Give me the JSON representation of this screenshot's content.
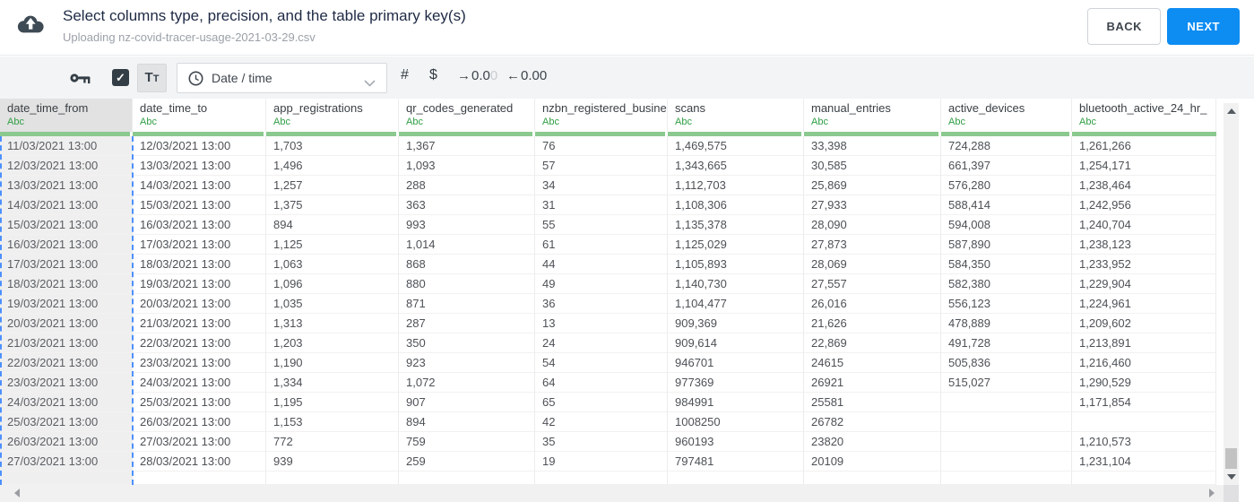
{
  "header": {
    "title": "Select columns type, precision, and the table primary key(s)",
    "subtitle": "Uploading nz-covid-tracer-usage-2021-03-29.csv",
    "back_label": "BACK",
    "next_label": "NEXT"
  },
  "toolbar": {
    "key_icon": "primary-key-icon",
    "checkbox_checked": true,
    "check_glyph": "✓",
    "text_type": {
      "big": "T",
      "small": "T"
    },
    "type_dropdown": {
      "value": "Date / time",
      "icon": "clock-icon"
    },
    "number_symbol": "#",
    "currency_symbol": "$",
    "increase_decimal": {
      "arrow": "→",
      "dark": "0.0",
      "light": "0"
    },
    "decrease_decimal": {
      "arrow": "←",
      "dark": "0.00"
    }
  },
  "table": {
    "columns": [
      {
        "name": "date_time_from",
        "type": "Abc",
        "selected": true
      },
      {
        "name": "date_time_to",
        "type": "Abc",
        "selected": false
      },
      {
        "name": "app_registrations",
        "type": "Abc",
        "selected": false
      },
      {
        "name": "qr_codes_generated",
        "type": "Abc",
        "selected": false
      },
      {
        "name": "nzbn_registered_busine",
        "type": "Abc",
        "selected": false
      },
      {
        "name": "scans",
        "type": "Abc",
        "selected": false
      },
      {
        "name": "manual_entries",
        "type": "Abc",
        "selected": false
      },
      {
        "name": "active_devices",
        "type": "Abc",
        "selected": false
      },
      {
        "name": "bluetooth_active_24_hr_",
        "type": "Abc",
        "selected": false
      }
    ],
    "rows": [
      [
        "11/03/2021 13:00",
        "12/03/2021 13:00",
        "1,703",
        "1,367",
        "76",
        "1,469,575",
        "33,398",
        "724,288",
        "1,261,266"
      ],
      [
        "12/03/2021 13:00",
        "13/03/2021 13:00",
        "1,496",
        "1,093",
        "57",
        "1,343,665",
        "30,585",
        "661,397",
        "1,254,171"
      ],
      [
        "13/03/2021 13:00",
        "14/03/2021 13:00",
        "1,257",
        "288",
        "34",
        "1,112,703",
        "25,869",
        "576,280",
        "1,238,464"
      ],
      [
        "14/03/2021 13:00",
        "15/03/2021 13:00",
        "1,375",
        "363",
        "31",
        "1,108,306",
        "27,933",
        "588,414",
        "1,242,956"
      ],
      [
        "15/03/2021 13:00",
        "16/03/2021 13:00",
        "894",
        "993",
        "55",
        "1,135,378",
        "28,090",
        "594,008",
        "1,240,704"
      ],
      [
        "16/03/2021 13:00",
        "17/03/2021 13:00",
        "1,125",
        "1,014",
        "61",
        "1,125,029",
        "27,873",
        "587,890",
        "1,238,123"
      ],
      [
        "17/03/2021 13:00",
        "18/03/2021 13:00",
        "1,063",
        "868",
        "44",
        "1,105,893",
        "28,069",
        "584,350",
        "1,233,952"
      ],
      [
        "18/03/2021 13:00",
        "19/03/2021 13:00",
        "1,096",
        "880",
        "49",
        "1,140,730",
        "27,557",
        "582,380",
        "1,229,904"
      ],
      [
        "19/03/2021 13:00",
        "20/03/2021 13:00",
        "1,035",
        "871",
        "36",
        "1,104,477",
        "26,016",
        "556,123",
        "1,224,961"
      ],
      [
        "20/03/2021 13:00",
        "21/03/2021 13:00",
        "1,313",
        "287",
        "13",
        "909,369",
        "21,626",
        "478,889",
        "1,209,602"
      ],
      [
        "21/03/2021 13:00",
        "22/03/2021 13:00",
        "1,203",
        "350",
        "24",
        "909,614",
        "22,869",
        "491,728",
        "1,213,891"
      ],
      [
        "22/03/2021 13:00",
        "23/03/2021 13:00",
        "1,190",
        "923",
        "54",
        "946701",
        "24615",
        "505,836",
        "1,216,460"
      ],
      [
        "23/03/2021 13:00",
        "24/03/2021 13:00",
        "1,334",
        "1,072",
        "64",
        "977369",
        "26921",
        "515,027",
        "1,290,529"
      ],
      [
        "24/03/2021 13:00",
        "25/03/2021 13:00",
        "1,195",
        "907",
        "65",
        "984991",
        "25581",
        "",
        "1,171,854"
      ],
      [
        "25/03/2021 13:00",
        "26/03/2021 13:00",
        "1,153",
        "894",
        "42",
        "1008250",
        "26782",
        "",
        ""
      ],
      [
        "26/03/2021 13:00",
        "27/03/2021 13:00",
        "772",
        "759",
        "35",
        "960193",
        "23820",
        "",
        "1,210,573"
      ],
      [
        "27/03/2021 13:00",
        "28/03/2021 13:00",
        "939",
        "259",
        "19",
        "797481",
        "20109",
        "",
        "1,231,104"
      ]
    ]
  },
  "colors": {
    "accent_blue": "#0d8cf2",
    "type_label_green": "#2f9e44",
    "column_bar_green": "#8bc98f",
    "selection_dashed_blue": "#4d90fe",
    "selected_column_bg": "#efefef"
  }
}
